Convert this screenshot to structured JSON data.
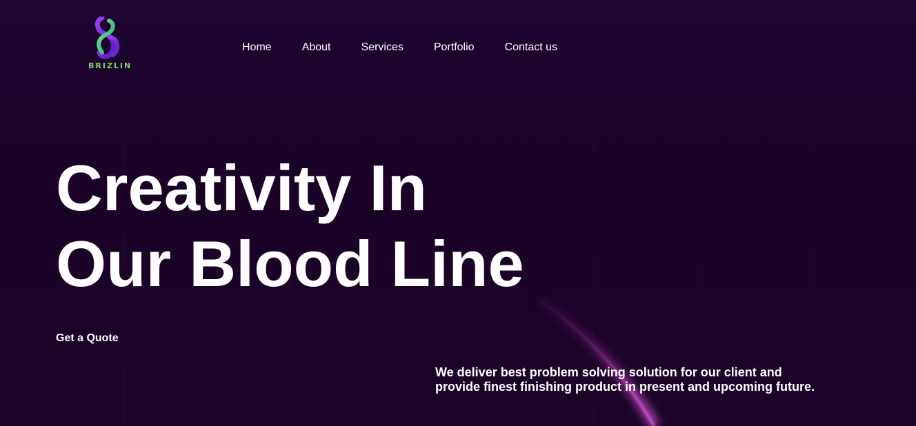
{
  "brand": {
    "name": "BRIZLIN",
    "logo_icon": "brizlin-b-logo-icon",
    "colors": {
      "background": "#1c0428",
      "logo_purple": "#7b2ff0",
      "logo_green": "#5fd38d",
      "accent_magenta": "#c640c8",
      "text": "#ffffff"
    }
  },
  "nav": {
    "items": [
      {
        "label": "Home"
      },
      {
        "label": "About"
      },
      {
        "label": "Services"
      },
      {
        "label": "Portfolio"
      },
      {
        "label": "Contact us"
      }
    ]
  },
  "hero": {
    "title_line1": "Creativity In",
    "title_line2": "Our Blood Line",
    "cta_label": "Get a Quote",
    "tagline_line1": "We deliver best problem solving solution for our client and",
    "tagline_line2": "provide finest finishing product in present and upcoming future."
  }
}
